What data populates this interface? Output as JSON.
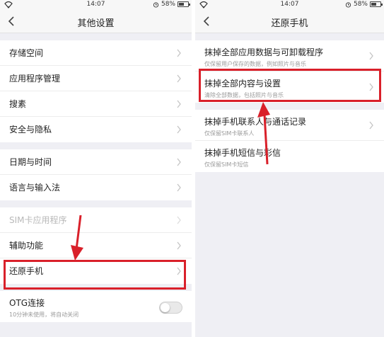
{
  "status": {
    "time": "14:07",
    "battery": "58%",
    "battery_level": 0.58
  },
  "left_screen": {
    "title": "其他设置",
    "groups": [
      [
        {
          "label": "存储空间"
        },
        {
          "label": "应用程序管理"
        },
        {
          "label": "搜素"
        },
        {
          "label": "安全与隐私"
        }
      ],
      [
        {
          "label": "日期与时间"
        },
        {
          "label": "语言与输入法"
        }
      ],
      [
        {
          "label": "SIM卡应用程序"
        },
        {
          "label": "辅助功能"
        },
        {
          "label": "还原手机"
        }
      ],
      [
        {
          "label": "OTG连接",
          "sub": "10分钟未使用，将自动关闭",
          "toggle_on": false
        }
      ]
    ]
  },
  "right_screen": {
    "title": "还原手机",
    "items": [
      {
        "label": "抹掉全部应用数据与可卸载程序",
        "sub": "仅保留用户保存的数据，例如照片与音乐"
      },
      {
        "label": "抹掉全部内容与设置",
        "sub": "清除全部数据，包括照片与音乐"
      },
      {
        "label": "抹掉手机联系人与通话记录",
        "sub": "仅保留SIM卡联系人"
      },
      {
        "label": "抹掉手机短信与彩信",
        "sub": "仅保留SIM卡短信"
      }
    ]
  },
  "colors": {
    "highlight": "#d9202a",
    "background": "#efeff4"
  }
}
